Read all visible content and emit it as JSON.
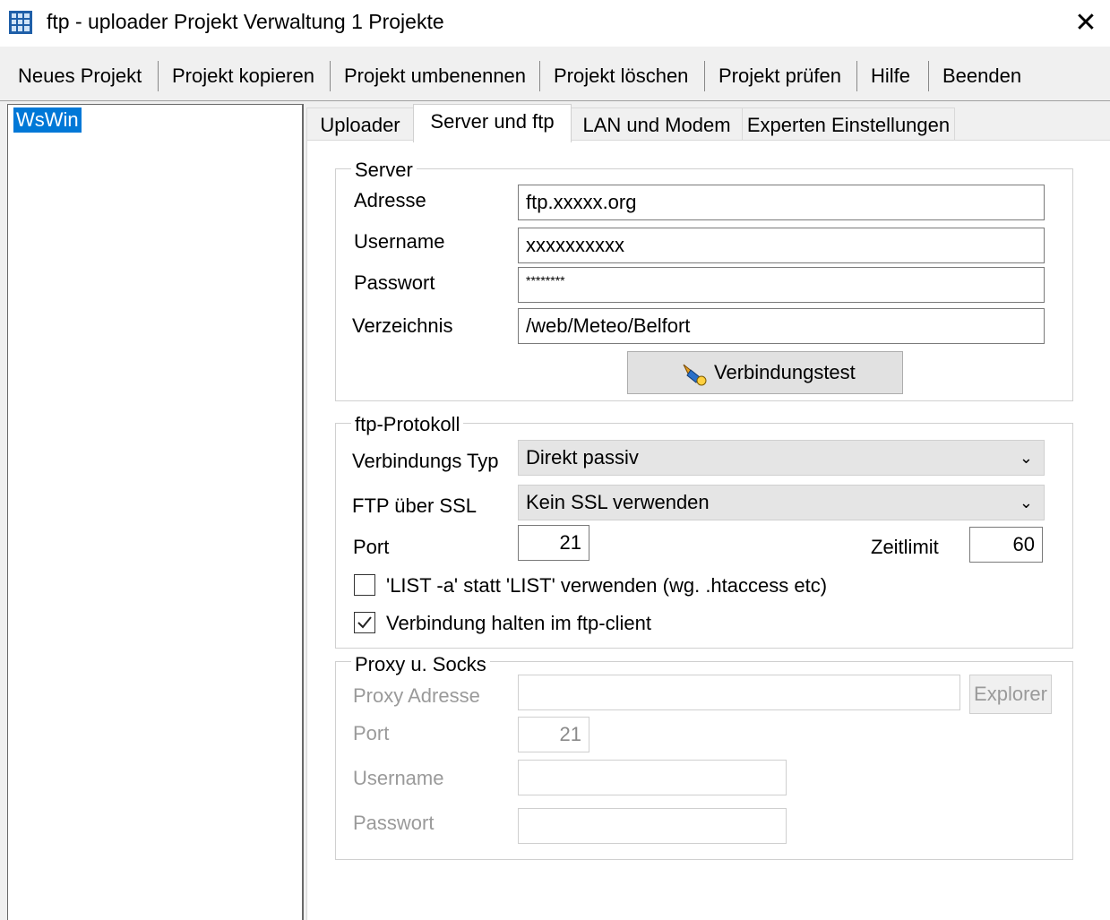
{
  "window": {
    "title": "ftp - uploader Projekt Verwaltung 1 Projekte",
    "close_glyph": "✕"
  },
  "menu": [
    "Neues Projekt",
    "Projekt kopieren",
    "Projekt umbenennen",
    "Projekt löschen",
    "Projekt prüfen",
    "Hilfe",
    "Beenden"
  ],
  "tree": {
    "items": [
      "WsWin"
    ]
  },
  "tabs": [
    "Uploader",
    "Server und ftp",
    "LAN und Modem",
    "Experten Einstellungen"
  ],
  "active_tab": "Server und ftp",
  "server": {
    "legend": "Server",
    "address_label": "Adresse",
    "address_value": "ftp.xxxxx.org",
    "username_label": "Username",
    "username_value": "xxxxxxxxxx",
    "password_label": "Passwort",
    "password_value": "********",
    "directory_label": "Verzeichnis",
    "directory_value": "/web/Meteo/Belfort",
    "test_button": "Verbindungstest"
  },
  "ftp": {
    "legend": "ftp-Protokoll",
    "conn_type_label": "Verbindungs Typ",
    "conn_type_value": "Direkt passiv",
    "ssl_label": "FTP über SSL",
    "ssl_value": "Kein SSL verwenden",
    "port_label": "Port",
    "port_value": "21",
    "timeout_label": "Zeitlimit",
    "timeout_value": "60",
    "list_a_label": "'LIST -a' statt 'LIST' verwenden (wg. .htaccess etc)",
    "list_a_checked": false,
    "keepalive_label": "Verbindung halten im ftp-client",
    "keepalive_checked": true
  },
  "proxy": {
    "legend": "Proxy u. Socks",
    "address_label": "Proxy Adresse",
    "address_value": "",
    "explorer_button": "Explorer",
    "port_label": "Port",
    "port_value": "21",
    "username_label": "Username",
    "username_value": "",
    "password_label": "Passwort",
    "password_value": ""
  },
  "colors": {
    "selection": "#0078d7",
    "disabled_text": "#9a9a9a"
  },
  "icons": {
    "app": "grid-app-icon",
    "test": "plug-connection-icon",
    "dropdown": "chevron-down-icon",
    "check": "checkmark-icon"
  }
}
